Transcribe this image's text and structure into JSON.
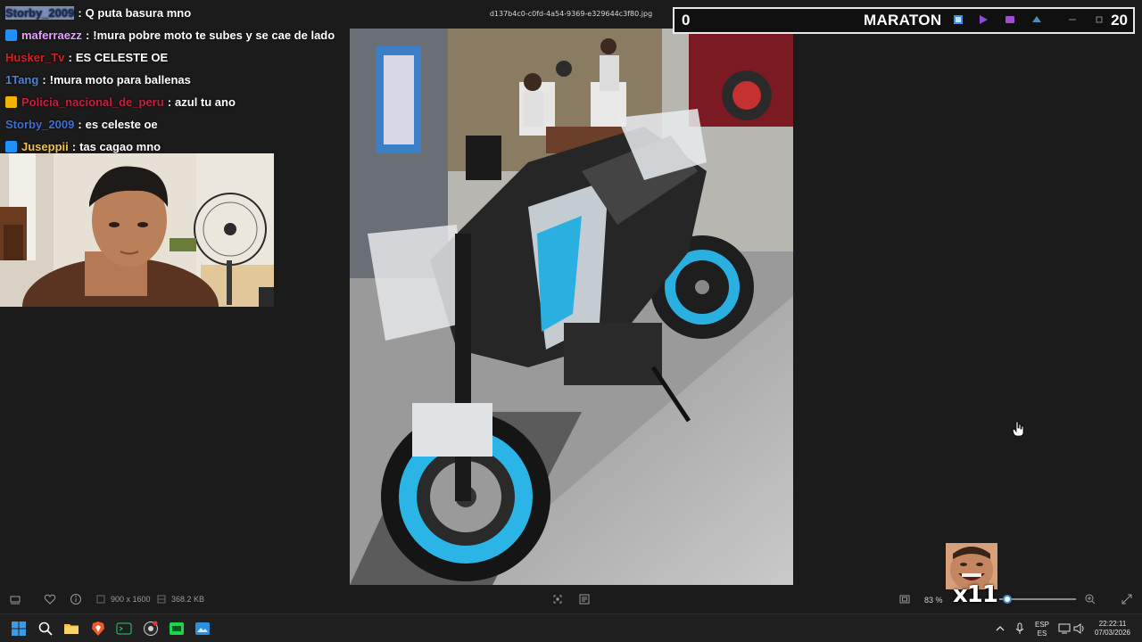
{
  "viewer": {
    "filename": "d137b4c0-c0fd-4a54-9369-e329644c3f80.jpg",
    "dimensions": "900 x 1600",
    "file_size": "368.2 KB",
    "zoom": "83 %",
    "zoom_fraction": 0.1
  },
  "chat": [
    {
      "user": "Storby_2009",
      "sep": ":",
      "message": "Q puta basura mno",
      "user_color": "#3d6fd6",
      "badge_color": "",
      "highlight": true
    },
    {
      "user": "maferraezz",
      "sep": ":",
      "message": "!mura pobre moto te subes y se cae de lado",
      "user_color": "#e6a0ff",
      "badge_color": "#1e90ff"
    },
    {
      "user": "Husker_Tv",
      "sep": ":",
      "message": "ES CELESTE OE",
      "user_color": "#d62020",
      "badge_color": ""
    },
    {
      "user": "1Tang",
      "sep": ":",
      "message": "!mura moto para ballenas",
      "user_color": "#4f7fe0",
      "badge_color": ""
    },
    {
      "user": "Policia_nacional_de_peru",
      "sep": ":",
      "message": "azul tu ano",
      "user_color": "#c81e3a",
      "badge_color": "#f0b400"
    },
    {
      "user": "Storby_2009",
      "sep": ":",
      "message": "es celeste oe",
      "user_color": "#3d6fd6",
      "badge_color": ""
    },
    {
      "user": "Juseppii",
      "sep": ":",
      "message": "tas cagao mno",
      "user_color": "#f2c14e",
      "badge_color": "#1e90ff"
    }
  ],
  "maraton": {
    "left_value": "0",
    "title": "MARATON",
    "right_value": "20"
  },
  "emote": {
    "count": "x11"
  },
  "taskbar": {
    "lang_top": "ESP",
    "lang_bottom": "ES",
    "time": "22:22:11",
    "date": "07/03/2026"
  },
  "colors": {
    "background": "#1b1b1b",
    "taskbar": "#202020",
    "accent": "#3a8ee6"
  }
}
